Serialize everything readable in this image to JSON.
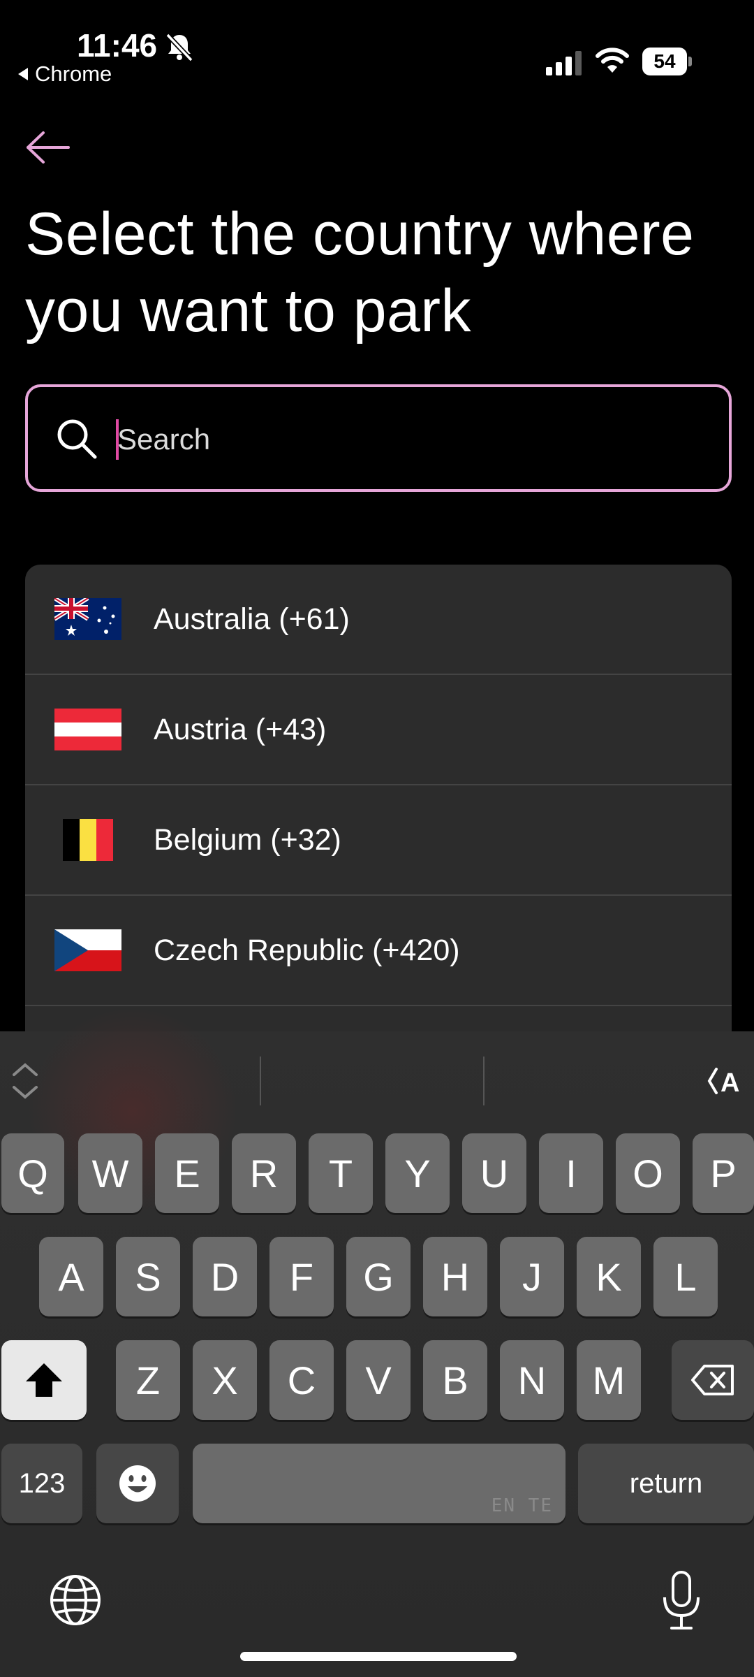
{
  "status_bar": {
    "time": "11:46",
    "back_app": "Chrome",
    "battery": "54"
  },
  "header": {
    "title": "Select the country where\nyou want to park"
  },
  "search": {
    "placeholder": "Search",
    "value": ""
  },
  "countries": [
    {
      "label": "Australia (+61)",
      "flag": "australia-flag"
    },
    {
      "label": "Austria (+43)",
      "flag": "austria-flag"
    },
    {
      "label": "Belgium (+32)",
      "flag": "belgium-flag"
    },
    {
      "label": "Czech Republic (+420)",
      "flag": "czech-flag"
    }
  ],
  "keyboard": {
    "row1": [
      "Q",
      "W",
      "E",
      "R",
      "T",
      "Y",
      "U",
      "I",
      "O",
      "P"
    ],
    "row2": [
      "A",
      "S",
      "D",
      "F",
      "G",
      "H",
      "J",
      "K",
      "L"
    ],
    "row3": [
      "Z",
      "X",
      "C",
      "V",
      "B",
      "N",
      "M"
    ],
    "numbers_key": "123",
    "return_key": "return",
    "space_note": "EN TE"
  },
  "colors": {
    "accent": "#e6a6d9",
    "caret": "#e04aa3",
    "list_bg": "#2c2c2c",
    "background": "#000000"
  }
}
